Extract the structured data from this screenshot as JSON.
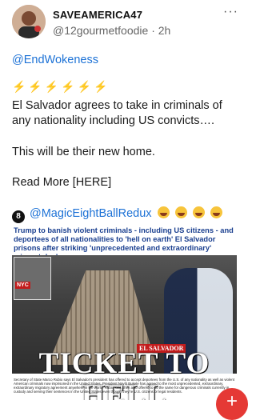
{
  "header": {
    "username": "SAVEAMERICA47",
    "handle": "@12gourmetfoodie",
    "separator": "·",
    "time": "2h",
    "more_icon": "more-horizontal-icon"
  },
  "post": {
    "hashtag": "@EndWokeness",
    "bolts": "⚡⚡⚡⚡⚡⚡",
    "text1": "El Salvador agrees to take in criminals of any nationality including US convicts….",
    "text2": "This will be their new home.",
    "text3": "Read More [HERE]"
  },
  "quote": {
    "handle": "@MagicEightBallRedux"
  },
  "news": {
    "headline": "Trump to banish violent criminals - including US citizens - and deportees of all nationalities to 'hell on earth' El Salvador prisons after striking 'unprecedented and extraordinary' migrant deal",
    "inset_tag": "NYC",
    "place_tag": "EL SALVADOR",
    "big_title": "TICKET TO HELL",
    "caption": "Secretary of State Marco Rubio says El Salvador's president has offered to accept deportees from the U.S. of any nationality as well as violent American criminals now imprisoned in the United States. President Nayib Bukele has agreed to the most unprecedented, extraordinary, extraordinary migratory agreement anywhere in the world. Rubio said, then also offered to do the same for dangerous criminals currently in custody and serving their sentences in the United States even though they're U.S. citizens or legal residents."
  },
  "fab": {
    "label": "+"
  }
}
